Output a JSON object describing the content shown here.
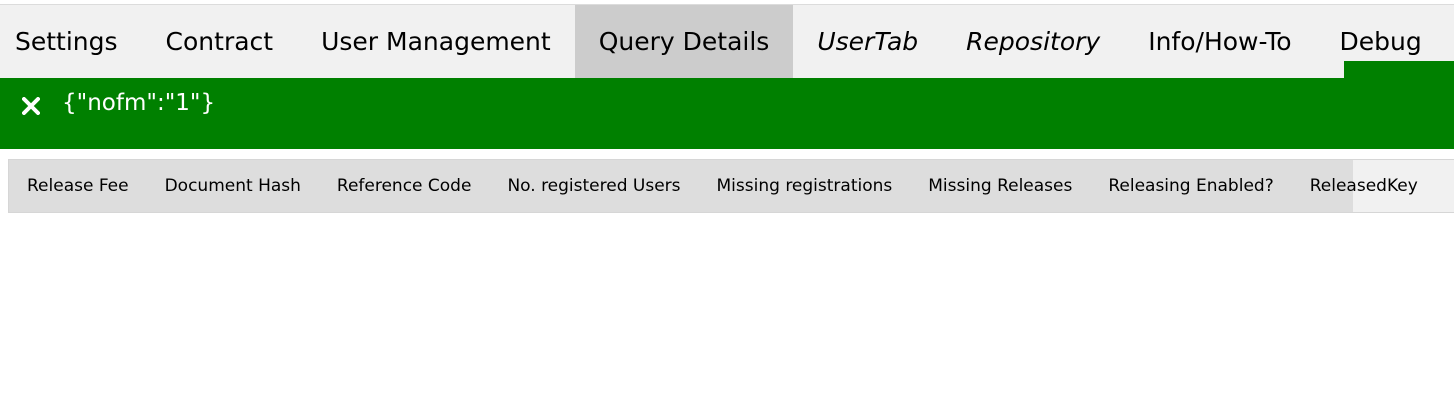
{
  "tabs": [
    {
      "label": "Settings",
      "italic": false,
      "active": false
    },
    {
      "label": "Contract",
      "italic": false,
      "active": false
    },
    {
      "label": "User Management",
      "italic": false,
      "active": false
    },
    {
      "label": "Query Details",
      "italic": false,
      "active": true
    },
    {
      "label": "UserTab",
      "italic": true,
      "active": false
    },
    {
      "label": "Repository",
      "italic": true,
      "active": false
    },
    {
      "label": "Info/How-To",
      "italic": false,
      "active": false
    },
    {
      "label": "Debug",
      "italic": false,
      "active": false
    }
  ],
  "alert": {
    "message": "{\"nofm\":\"1\"}",
    "color": "#008000",
    "close_icon": "close-icon"
  },
  "subtabs": [
    {
      "label": "Release Fee"
    },
    {
      "label": "Document Hash"
    },
    {
      "label": "Reference Code"
    },
    {
      "label": "No. registered Users"
    },
    {
      "label": "Missing registrations"
    },
    {
      "label": "Missing Releases"
    },
    {
      "label": "Releasing Enabled?"
    },
    {
      "label": "ReleasedKey"
    }
  ]
}
